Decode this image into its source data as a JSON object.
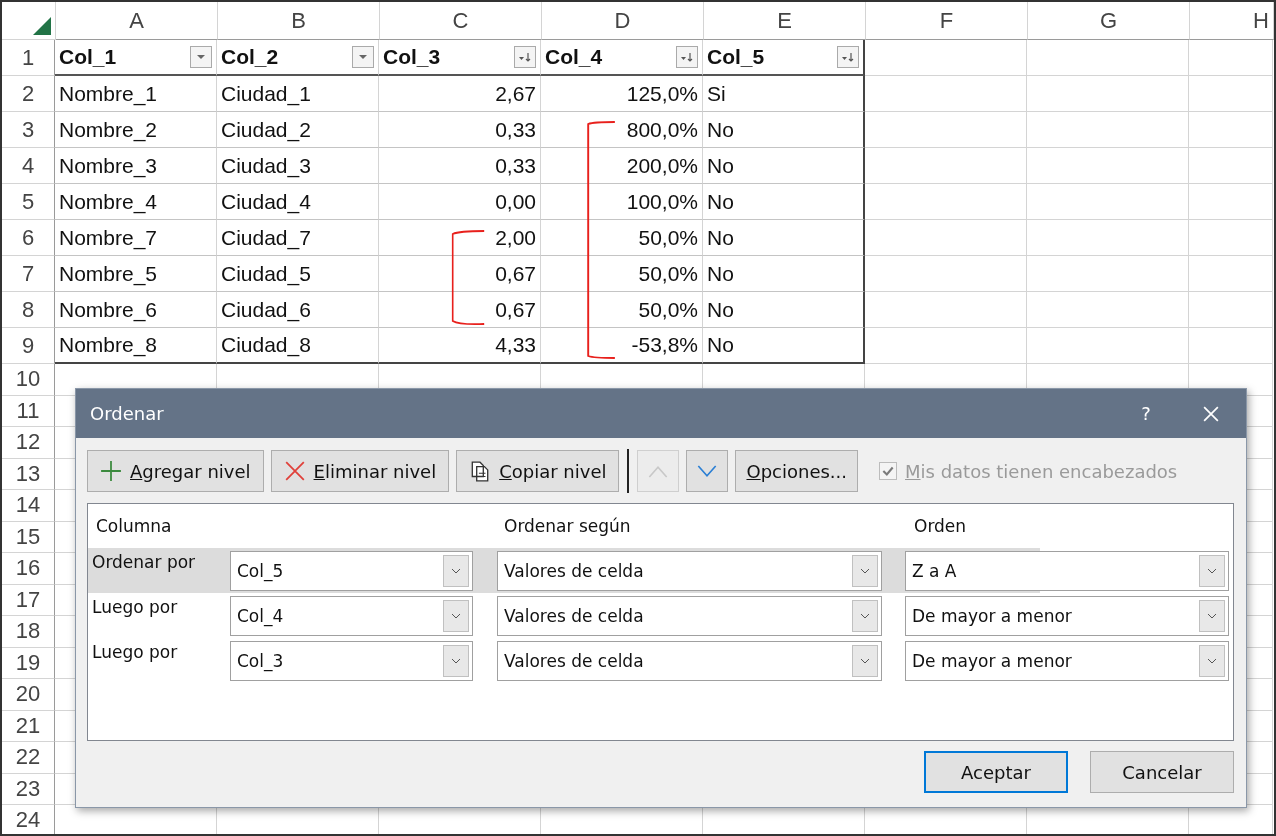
{
  "sheet": {
    "column_headers": [
      "A",
      "B",
      "C",
      "D",
      "E",
      "F",
      "G",
      "H"
    ],
    "row_numbers": [
      "1",
      "2",
      "3",
      "4",
      "5",
      "6",
      "7",
      "8",
      "9",
      "10",
      "11",
      "12",
      "13",
      "14",
      "15",
      "16",
      "17",
      "18",
      "19",
      "20",
      "21",
      "22",
      "23",
      "24"
    ],
    "table": {
      "columns": [
        {
          "label": "Col_1",
          "numeric": false,
          "sorted": false
        },
        {
          "label": "Col_2",
          "numeric": false,
          "sorted": false
        },
        {
          "label": "Col_3",
          "numeric": true,
          "sorted": true
        },
        {
          "label": "Col_4",
          "numeric": true,
          "sorted": true
        },
        {
          "label": "Col_5",
          "numeric": false,
          "sorted": true
        }
      ],
      "rows": [
        [
          "Nombre_1",
          "Ciudad_1",
          "2,67",
          "125,0%",
          "Si"
        ],
        [
          "Nombre_2",
          "Ciudad_2",
          "0,33",
          "800,0%",
          "No"
        ],
        [
          "Nombre_3",
          "Ciudad_3",
          "0,33",
          "200,0%",
          "No"
        ],
        [
          "Nombre_4",
          "Ciudad_4",
          "0,00",
          "100,0%",
          "No"
        ],
        [
          "Nombre_7",
          "Ciudad_7",
          "2,00",
          "50,0%",
          "No"
        ],
        [
          "Nombre_5",
          "Ciudad_5",
          "0,67",
          "50,0%",
          "No"
        ],
        [
          "Nombre_6",
          "Ciudad_6",
          "0,67",
          "50,0%",
          "No"
        ],
        [
          "Nombre_8",
          "Ciudad_8",
          "4,33",
          "-53,8%",
          "No"
        ]
      ]
    }
  },
  "dialog": {
    "title": "Ordenar",
    "help": "?",
    "toolbar": [
      {
        "label": "Agregar nivel",
        "kind": "add"
      },
      {
        "label": "Eliminar nivel",
        "kind": "delete"
      },
      {
        "label": "Copiar nivel",
        "kind": "copy"
      }
    ],
    "move_up": {
      "disabled": true
    },
    "move_down": {
      "disabled": false
    },
    "options_button": "Opciones...",
    "headers_checkbox": {
      "label": "Mis datos tienen encabezados",
      "checked": true,
      "disabled": true
    },
    "columns": [
      "Columna",
      "Ordenar según",
      "Orden"
    ],
    "levels": [
      {
        "label": "Ordenar por",
        "column": "Col_5",
        "sort_on": "Valores de celda",
        "order": "Z a A",
        "selected": true
      },
      {
        "label": "Luego por",
        "column": "Col_4",
        "sort_on": "Valores de celda",
        "order": "De mayor a menor",
        "selected": false
      },
      {
        "label": "Luego por",
        "column": "Col_3",
        "sort_on": "Valores de celda",
        "order": "De mayor a menor",
        "selected": false
      }
    ],
    "buttons": [
      {
        "label": "Aceptar",
        "default": true
      },
      {
        "label": "Cancelar",
        "default": false
      }
    ]
  }
}
